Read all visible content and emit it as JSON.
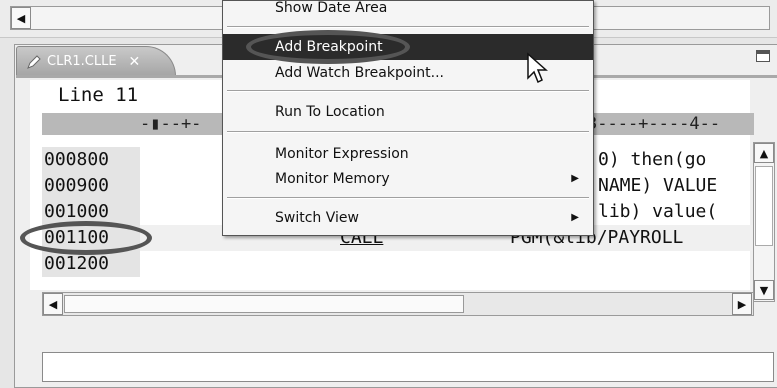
{
  "editor": {
    "tab_label": "CLR1.CLLE",
    "tab_close": "✕",
    "line_indicator": "Line 11",
    "ruler_left": "-▮--+-",
    "ruler_right": "3----+----4--",
    "lines": [
      {
        "num": "000800",
        "text": "0) then(go"
      },
      {
        "num": "000900",
        "text": "NAME) VALUE"
      },
      {
        "num": "001000",
        "text": "lib) value("
      },
      {
        "num": "001100",
        "keyword": "CALL",
        "text": "PGM(&lib/PAYROLL"
      },
      {
        "num": "001200",
        "text": ""
      }
    ]
  },
  "context_menu": {
    "items": [
      {
        "label": "Show Date Area"
      },
      {
        "label": "Add Breakpoint"
      },
      {
        "label": "Add Watch Breakpoint..."
      },
      {
        "label": "Run To Location"
      },
      {
        "label": "Monitor Expression"
      },
      {
        "label": "Monitor Memory",
        "submenu_arrow": "▶"
      },
      {
        "label": "Switch View",
        "submenu_arrow": "▶"
      }
    ]
  },
  "scroll": {
    "left_arrow": "◀",
    "right_arrow": "▶",
    "up_arrow": "▲",
    "down_arrow": "▼"
  }
}
